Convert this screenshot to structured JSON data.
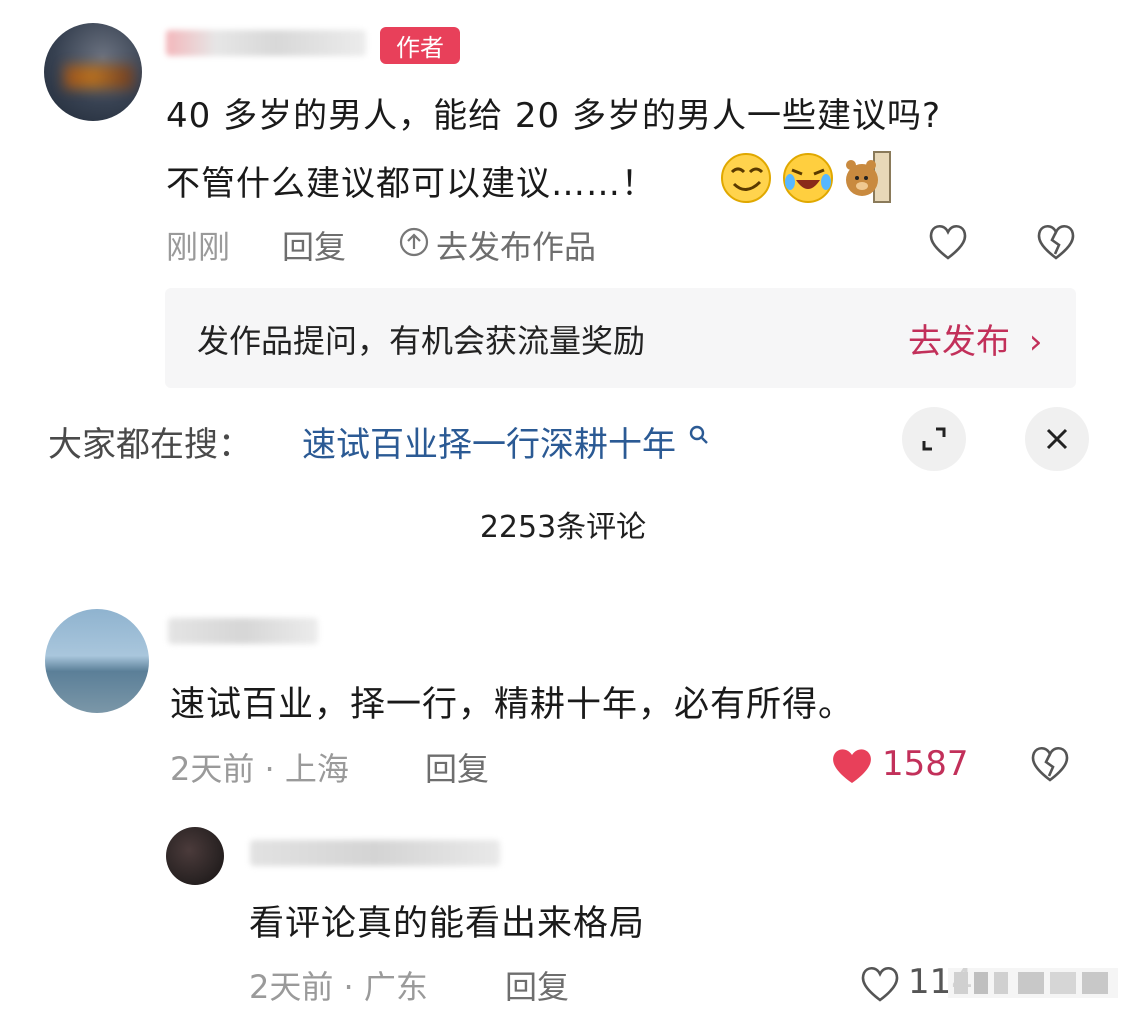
{
  "post": {
    "author_badge": "作者",
    "line1": "40 多岁的男人，能给 20 多岁的男人一些建议吗?",
    "line2": "不管什么建议都可以建议……！",
    "time": "刚刚",
    "reply": "回复",
    "publish_link": "去发布作品",
    "emojis": [
      "smirk-emoji",
      "laughing-crying-emoji",
      "bear-door-emoji"
    ]
  },
  "banner": {
    "text": "发作品提问，有机会获流量奖励",
    "link": "去发布",
    "chevron": "›"
  },
  "search": {
    "prefix": "大家都在搜：",
    "term": "速试百业择一行深耕十年"
  },
  "comments_count": "2253条评论",
  "comments": [
    {
      "text": "速试百业，择一行，精耕十年，必有所得。",
      "time_location": "2天前 · 上海",
      "reply": "回复",
      "likes": "1587",
      "liked": true
    },
    {
      "text": "看评论真的能看出来格局",
      "time_location": "2天前 · 广东",
      "reply": "回复",
      "likes": "114"
    }
  ],
  "colors": {
    "accent": "#e8405a",
    "link": "#2b5a94",
    "liked": "#e8405a"
  }
}
